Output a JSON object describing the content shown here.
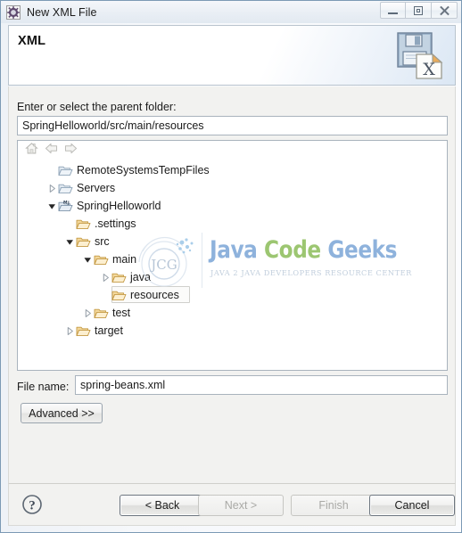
{
  "window": {
    "title": "New XML File",
    "title_icon": "xml-gear-icon",
    "controls": [
      {
        "name": "minimize-button",
        "icon": "minimize-icon"
      },
      {
        "name": "maximize-button",
        "icon": "maximize-icon"
      },
      {
        "name": "close-button",
        "icon": "close-icon"
      }
    ]
  },
  "banner": {
    "title": "XML",
    "icon": "xml-file-save-icon",
    "ghost_line_1": "",
    "ghost_line_2": ""
  },
  "form": {
    "parent_folder_label": "Enter or select the parent folder:",
    "parent_folder_value": "SpringHelloworld/src/main/resources",
    "parent_folder_placeholder": "Enter or select the parent folder",
    "filename_label": "File name:",
    "filename_value": "spring-beans.xml",
    "filename_placeholder": "File name",
    "advanced_label": "Advanced >>"
  },
  "tree": {
    "toolbar": [
      {
        "name": "home-icon",
        "label": "Home"
      },
      {
        "name": "back-arrow-icon",
        "label": "Back"
      },
      {
        "name": "forward-arrow-icon",
        "label": "Forward"
      }
    ],
    "rows": [
      {
        "label": "RemoteSystemsTempFiles",
        "depth": 1,
        "twisty": "none",
        "icon": "folder-grey-icon",
        "selected": false
      },
      {
        "label": "Servers",
        "depth": 1,
        "twisty": "collapsed",
        "icon": "folder-grey-icon",
        "selected": false
      },
      {
        "label": "SpringHelloworld",
        "depth": 1,
        "twisty": "expanded",
        "icon": "maven-project-icon",
        "selected": false
      },
      {
        "label": ".settings",
        "depth": 2,
        "twisty": "none",
        "icon": "folder-icon",
        "selected": false
      },
      {
        "label": "src",
        "depth": 2,
        "twisty": "expanded",
        "icon": "folder-icon",
        "selected": false
      },
      {
        "label": "main",
        "depth": 3,
        "twisty": "expanded",
        "icon": "folder-icon",
        "selected": false
      },
      {
        "label": "java",
        "depth": 4,
        "twisty": "collapsed",
        "icon": "folder-icon",
        "selected": false
      },
      {
        "label": "resources",
        "depth": 4,
        "twisty": "none",
        "icon": "folder-icon",
        "selected": true
      },
      {
        "label": "test",
        "depth": 3,
        "twisty": "collapsed",
        "icon": "folder-icon",
        "selected": false
      },
      {
        "label": "target",
        "depth": 2,
        "twisty": "collapsed",
        "icon": "folder-icon",
        "selected": false
      }
    ]
  },
  "footer": {
    "help_icon": "help-question-icon",
    "buttons": [
      {
        "name": "back-button",
        "label": "< Back",
        "enabled": true
      },
      {
        "name": "next-button",
        "label": "Next >",
        "enabled": false
      },
      {
        "name": "finish-button",
        "label": "Finish",
        "enabled": false
      },
      {
        "name": "cancel-button",
        "label": "Cancel",
        "enabled": true
      }
    ]
  },
  "watermark": {
    "logo_text": "JCG",
    "word_1": "Java",
    "word_2": "Code",
    "word_3": "Geeks",
    "subtitle": "JAVA 2 JAVA DEVELOPERS RESOURCE CENTER",
    "color_blue": "#7fa8d8",
    "color_green": "#8fbf5e"
  }
}
